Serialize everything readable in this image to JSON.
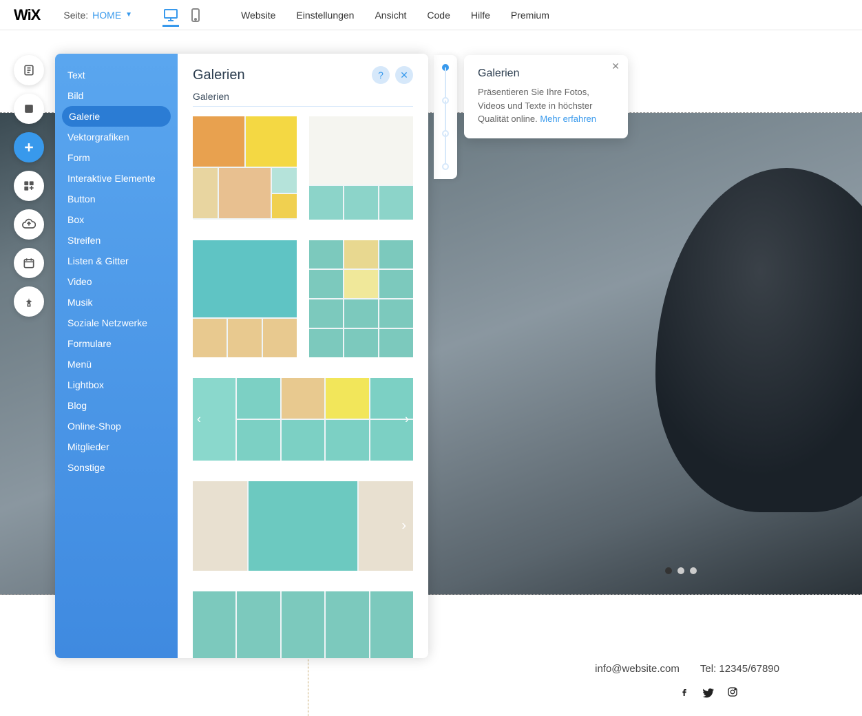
{
  "topbar": {
    "logo": "WiX",
    "page_label": "Seite:",
    "page_name": "HOME",
    "menu": [
      "Website",
      "Einstellungen",
      "Ansicht",
      "Code",
      "Hilfe",
      "Premium"
    ]
  },
  "categories": [
    "Text",
    "Bild",
    "Galerie",
    "Vektorgrafiken",
    "Form",
    "Interaktive Elemente",
    "Button",
    "Box",
    "Streifen",
    "Listen & Gitter",
    "Video",
    "Musik",
    "Soziale Netzwerke",
    "Formulare",
    "Menü",
    "Lightbox",
    "Blog",
    "Online-Shop",
    "Mitglieder",
    "Sonstige"
  ],
  "selected_category_index": 2,
  "panel": {
    "title": "Galerien",
    "subtitle": "Galerien"
  },
  "tooltip": {
    "title": "Galerien",
    "text": "Präsentieren Sie Ihre Fotos, Videos und Texte in höchster Qualität online. ",
    "link_text": "Mehr erfahren"
  },
  "footer": {
    "email": "info@website.com",
    "tel": "Tel: 12345/67890"
  }
}
